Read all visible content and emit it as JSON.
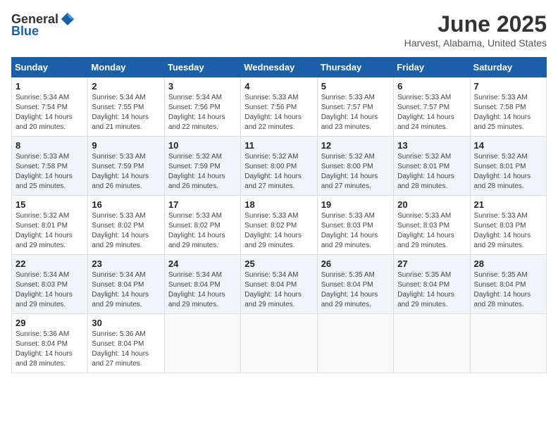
{
  "header": {
    "logo_general": "General",
    "logo_blue": "Blue",
    "month_title": "June 2025",
    "location": "Harvest, Alabama, United States"
  },
  "weekdays": [
    "Sunday",
    "Monday",
    "Tuesday",
    "Wednesday",
    "Thursday",
    "Friday",
    "Saturday"
  ],
  "weeks": [
    [
      {
        "day": "1",
        "info": "Sunrise: 5:34 AM\nSunset: 7:54 PM\nDaylight: 14 hours\nand 20 minutes."
      },
      {
        "day": "2",
        "info": "Sunrise: 5:34 AM\nSunset: 7:55 PM\nDaylight: 14 hours\nand 21 minutes."
      },
      {
        "day": "3",
        "info": "Sunrise: 5:34 AM\nSunset: 7:56 PM\nDaylight: 14 hours\nand 22 minutes."
      },
      {
        "day": "4",
        "info": "Sunrise: 5:33 AM\nSunset: 7:56 PM\nDaylight: 14 hours\nand 22 minutes."
      },
      {
        "day": "5",
        "info": "Sunrise: 5:33 AM\nSunset: 7:57 PM\nDaylight: 14 hours\nand 23 minutes."
      },
      {
        "day": "6",
        "info": "Sunrise: 5:33 AM\nSunset: 7:57 PM\nDaylight: 14 hours\nand 24 minutes."
      },
      {
        "day": "7",
        "info": "Sunrise: 5:33 AM\nSunset: 7:58 PM\nDaylight: 14 hours\nand 25 minutes."
      }
    ],
    [
      {
        "day": "8",
        "info": "Sunrise: 5:33 AM\nSunset: 7:58 PM\nDaylight: 14 hours\nand 25 minutes."
      },
      {
        "day": "9",
        "info": "Sunrise: 5:33 AM\nSunset: 7:59 PM\nDaylight: 14 hours\nand 26 minutes."
      },
      {
        "day": "10",
        "info": "Sunrise: 5:32 AM\nSunset: 7:59 PM\nDaylight: 14 hours\nand 26 minutes."
      },
      {
        "day": "11",
        "info": "Sunrise: 5:32 AM\nSunset: 8:00 PM\nDaylight: 14 hours\nand 27 minutes."
      },
      {
        "day": "12",
        "info": "Sunrise: 5:32 AM\nSunset: 8:00 PM\nDaylight: 14 hours\nand 27 minutes."
      },
      {
        "day": "13",
        "info": "Sunrise: 5:32 AM\nSunset: 8:01 PM\nDaylight: 14 hours\nand 28 minutes."
      },
      {
        "day": "14",
        "info": "Sunrise: 5:32 AM\nSunset: 8:01 PM\nDaylight: 14 hours\nand 28 minutes."
      }
    ],
    [
      {
        "day": "15",
        "info": "Sunrise: 5:32 AM\nSunset: 8:01 PM\nDaylight: 14 hours\nand 29 minutes."
      },
      {
        "day": "16",
        "info": "Sunrise: 5:33 AM\nSunset: 8:02 PM\nDaylight: 14 hours\nand 29 minutes."
      },
      {
        "day": "17",
        "info": "Sunrise: 5:33 AM\nSunset: 8:02 PM\nDaylight: 14 hours\nand 29 minutes."
      },
      {
        "day": "18",
        "info": "Sunrise: 5:33 AM\nSunset: 8:02 PM\nDaylight: 14 hours\nand 29 minutes."
      },
      {
        "day": "19",
        "info": "Sunrise: 5:33 AM\nSunset: 8:03 PM\nDaylight: 14 hours\nand 29 minutes."
      },
      {
        "day": "20",
        "info": "Sunrise: 5:33 AM\nSunset: 8:03 PM\nDaylight: 14 hours\nand 29 minutes."
      },
      {
        "day": "21",
        "info": "Sunrise: 5:33 AM\nSunset: 8:03 PM\nDaylight: 14 hours\nand 29 minutes."
      }
    ],
    [
      {
        "day": "22",
        "info": "Sunrise: 5:34 AM\nSunset: 8:03 PM\nDaylight: 14 hours\nand 29 minutes."
      },
      {
        "day": "23",
        "info": "Sunrise: 5:34 AM\nSunset: 8:04 PM\nDaylight: 14 hours\nand 29 minutes."
      },
      {
        "day": "24",
        "info": "Sunrise: 5:34 AM\nSunset: 8:04 PM\nDaylight: 14 hours\nand 29 minutes."
      },
      {
        "day": "25",
        "info": "Sunrise: 5:34 AM\nSunset: 8:04 PM\nDaylight: 14 hours\nand 29 minutes."
      },
      {
        "day": "26",
        "info": "Sunrise: 5:35 AM\nSunset: 8:04 PM\nDaylight: 14 hours\nand 29 minutes."
      },
      {
        "day": "27",
        "info": "Sunrise: 5:35 AM\nSunset: 8:04 PM\nDaylight: 14 hours\nand 29 minutes."
      },
      {
        "day": "28",
        "info": "Sunrise: 5:35 AM\nSunset: 8:04 PM\nDaylight: 14 hours\nand 28 minutes."
      }
    ],
    [
      {
        "day": "29",
        "info": "Sunrise: 5:36 AM\nSunset: 8:04 PM\nDaylight: 14 hours\nand 28 minutes."
      },
      {
        "day": "30",
        "info": "Sunrise: 5:36 AM\nSunset: 8:04 PM\nDaylight: 14 hours\nand 27 minutes."
      },
      {
        "day": "",
        "info": ""
      },
      {
        "day": "",
        "info": ""
      },
      {
        "day": "",
        "info": ""
      },
      {
        "day": "",
        "info": ""
      },
      {
        "day": "",
        "info": ""
      }
    ]
  ]
}
